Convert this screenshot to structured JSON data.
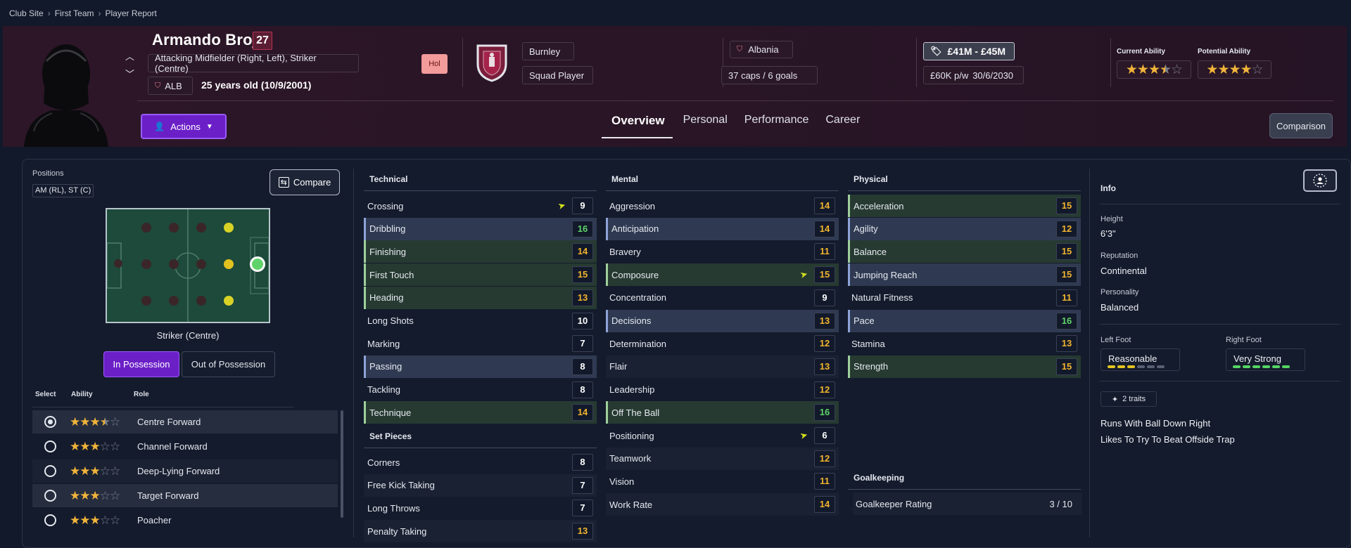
{
  "breadcrumb": [
    "Club Site",
    "First Team",
    "Player Report"
  ],
  "player": {
    "name": "Armando Broja",
    "number": "27",
    "positions_label": "Attacking Midfielder (Right, Left), Striker (Centre)",
    "nation_code": "ALB",
    "age_text": "25 years old (10/9/2001)",
    "status_badge": "Hol"
  },
  "club": {
    "name": "Burnley",
    "squad_status": "Squad Player"
  },
  "nation": {
    "name": "Albania",
    "caps": "37 caps / 6 goals"
  },
  "contract": {
    "value": "£41M - £45M",
    "wage": "£60K p/w",
    "expires": "30/6/2030"
  },
  "ability": {
    "current_label": "Current Ability",
    "current_stars": 3.5,
    "potential_label": "Potential Ability",
    "potential_stars": 4
  },
  "actions_label": "Actions",
  "comparison_label": "Comparison",
  "tabs": [
    "Overview",
    "Personal",
    "Performance",
    "Career"
  ],
  "positions_panel": {
    "title": "Positions",
    "value": "AM (RL), ST (C)",
    "compare_label": "Compare",
    "selected_position": "Striker (Centre)",
    "in_possession": "In Possession",
    "out_of_possession": "Out of Possession"
  },
  "roles": {
    "headers": [
      "Select",
      "Ability",
      "Role"
    ],
    "items": [
      {
        "name": "Centre Forward",
        "stars": 3.5,
        "selected": true
      },
      {
        "name": "Channel Forward",
        "stars": 3,
        "selected": false
      },
      {
        "name": "Deep-Lying Forward",
        "stars": 3,
        "selected": false
      },
      {
        "name": "Target Forward",
        "stars": 3,
        "selected": false
      },
      {
        "name": "Poacher",
        "stars": 3,
        "selected": false
      }
    ]
  },
  "technical": {
    "title": "Technical",
    "items": [
      {
        "name": "Crossing",
        "value": "9",
        "color": "#ffffff",
        "highlight": "",
        "arrow": true
      },
      {
        "name": "Dribbling",
        "value": "16",
        "color": "#5fd36a",
        "highlight": "b",
        "arrow": false
      },
      {
        "name": "Finishing",
        "value": "14",
        "color": "#f1b42f",
        "highlight": "g",
        "arrow": false
      },
      {
        "name": "First Touch",
        "value": "15",
        "color": "#f1b42f",
        "highlight": "g",
        "arrow": false
      },
      {
        "name": "Heading",
        "value": "13",
        "color": "#f1b42f",
        "highlight": "g",
        "arrow": false
      },
      {
        "name": "Long Shots",
        "value": "10",
        "color": "#ffffff",
        "highlight": "",
        "arrow": false
      },
      {
        "name": "Marking",
        "value": "7",
        "color": "#ffffff",
        "highlight": "",
        "arrow": false
      },
      {
        "name": "Passing",
        "value": "8",
        "color": "#ffffff",
        "highlight": "b",
        "arrow": false
      },
      {
        "name": "Tackling",
        "value": "8",
        "color": "#ffffff",
        "highlight": "",
        "arrow": false
      },
      {
        "name": "Technique",
        "value": "14",
        "color": "#f1b42f",
        "highlight": "g",
        "arrow": false
      }
    ]
  },
  "set_pieces": {
    "title": "Set Pieces",
    "items": [
      {
        "name": "Corners",
        "value": "8",
        "color": "#ffffff",
        "highlight": "",
        "arrow": false
      },
      {
        "name": "Free Kick Taking",
        "value": "7",
        "color": "#ffffff",
        "highlight": "dk",
        "arrow": false
      },
      {
        "name": "Long Throws",
        "value": "7",
        "color": "#ffffff",
        "highlight": "",
        "arrow": false
      },
      {
        "name": "Penalty Taking",
        "value": "13",
        "color": "#f1b42f",
        "highlight": "dk",
        "arrow": false
      }
    ]
  },
  "mental": {
    "title": "Mental",
    "items": [
      {
        "name": "Aggression",
        "value": "14",
        "color": "#f1b42f",
        "highlight": "",
        "arrow": false
      },
      {
        "name": "Anticipation",
        "value": "14",
        "color": "#f1b42f",
        "highlight": "b",
        "arrow": false
      },
      {
        "name": "Bravery",
        "value": "11",
        "color": "#f1b42f",
        "highlight": "",
        "arrow": false
      },
      {
        "name": "Composure",
        "value": "15",
        "color": "#f1b42f",
        "highlight": "g",
        "arrow": true
      },
      {
        "name": "Concentration",
        "value": "9",
        "color": "#ffffff",
        "highlight": "",
        "arrow": false
      },
      {
        "name": "Decisions",
        "value": "13",
        "color": "#f1b42f",
        "highlight": "b",
        "arrow": false
      },
      {
        "name": "Determination",
        "value": "12",
        "color": "#f1b42f",
        "highlight": "",
        "arrow": false
      },
      {
        "name": "Flair",
        "value": "13",
        "color": "#f1b42f",
        "highlight": "dk",
        "arrow": false
      },
      {
        "name": "Leadership",
        "value": "12",
        "color": "#f1b42f",
        "highlight": "",
        "arrow": false
      },
      {
        "name": "Off The Ball",
        "value": "16",
        "color": "#5fd36a",
        "highlight": "g",
        "arrow": false
      },
      {
        "name": "Positioning",
        "value": "6",
        "color": "#ffffff",
        "highlight": "",
        "arrow": true
      },
      {
        "name": "Teamwork",
        "value": "12",
        "color": "#f1b42f",
        "highlight": "dk",
        "arrow": false
      },
      {
        "name": "Vision",
        "value": "11",
        "color": "#f1b42f",
        "highlight": "",
        "arrow": false
      },
      {
        "name": "Work Rate",
        "value": "14",
        "color": "#f1b42f",
        "highlight": "dk",
        "arrow": false
      }
    ]
  },
  "physical": {
    "title": "Physical",
    "items": [
      {
        "name": "Acceleration",
        "value": "15",
        "color": "#f1b42f",
        "highlight": "g",
        "arrow": false
      },
      {
        "name": "Agility",
        "value": "12",
        "color": "#f1b42f",
        "highlight": "b",
        "arrow": false
      },
      {
        "name": "Balance",
        "value": "15",
        "color": "#f1b42f",
        "highlight": "g",
        "arrow": false
      },
      {
        "name": "Jumping Reach",
        "value": "15",
        "color": "#f1b42f",
        "highlight": "b",
        "arrow": false
      },
      {
        "name": "Natural Fitness",
        "value": "11",
        "color": "#f1b42f",
        "highlight": "",
        "arrow": false
      },
      {
        "name": "Pace",
        "value": "16",
        "color": "#5fd36a",
        "highlight": "b",
        "arrow": false
      },
      {
        "name": "Stamina",
        "value": "13",
        "color": "#f1b42f",
        "highlight": "",
        "arrow": false
      },
      {
        "name": "Strength",
        "value": "15",
        "color": "#f1b42f",
        "highlight": "g",
        "arrow": false
      }
    ]
  },
  "goalkeeping": {
    "title": "Goalkeeping",
    "label": "Goalkeeper Rating",
    "value": "3 / 10"
  },
  "info": {
    "title": "Info",
    "height_label": "Height",
    "height": "6'3\"",
    "reputation_label": "Reputation",
    "reputation": "Continental",
    "personality_label": "Personality",
    "personality": "Balanced",
    "left_foot_label": "Left Foot",
    "left_foot": "Reasonable",
    "right_foot_label": "Right Foot",
    "right_foot": "Very Strong",
    "left_foot_level": 3,
    "right_foot_level": 6,
    "traits_label": "2 traits",
    "traits": [
      "Runs With Ball Down Right",
      "Likes To Try To Beat Offside Trap"
    ]
  }
}
